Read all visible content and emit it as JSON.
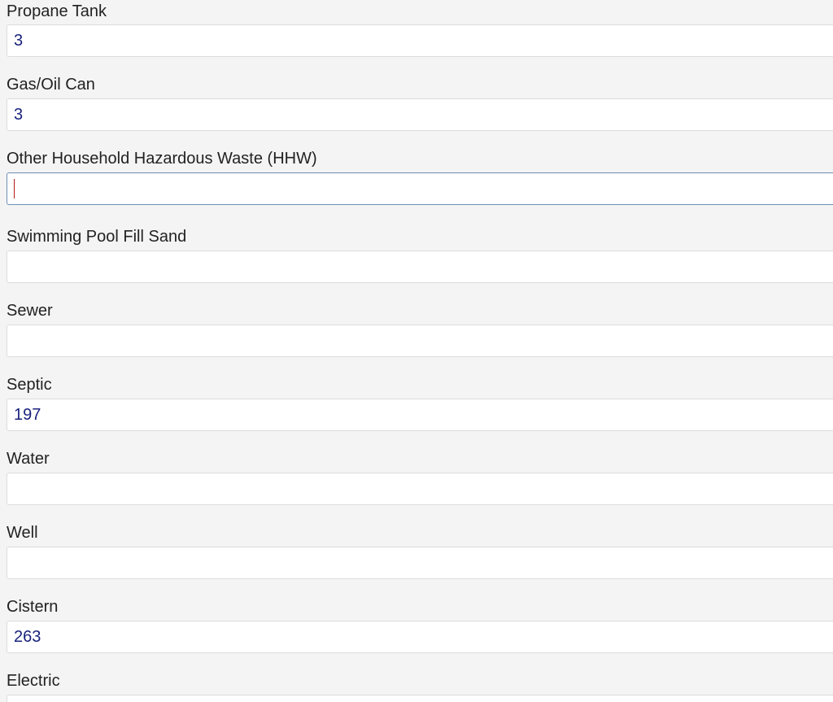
{
  "form": {
    "fields": [
      {
        "label": "Propane Tank",
        "value": "3"
      },
      {
        "label": "Gas/Oil Can",
        "value": "3"
      },
      {
        "label": "Other Household Hazardous Waste (HHW)",
        "value": "",
        "focused": true
      },
      {
        "label": "Swimming Pool Fill Sand",
        "value": ""
      },
      {
        "label": "Sewer",
        "value": ""
      },
      {
        "label": "Septic",
        "value": "197"
      },
      {
        "label": "Water",
        "value": ""
      },
      {
        "label": "Well",
        "value": ""
      },
      {
        "label": "Cistern",
        "value": "263"
      },
      {
        "label": "Electric",
        "value": ""
      }
    ]
  },
  "colors": {
    "background": "#f4f4f4",
    "input_background": "#ffffff",
    "value_text": "#1a237e",
    "focus_border": "#6e8fb3",
    "caret": "#b71c1c"
  }
}
